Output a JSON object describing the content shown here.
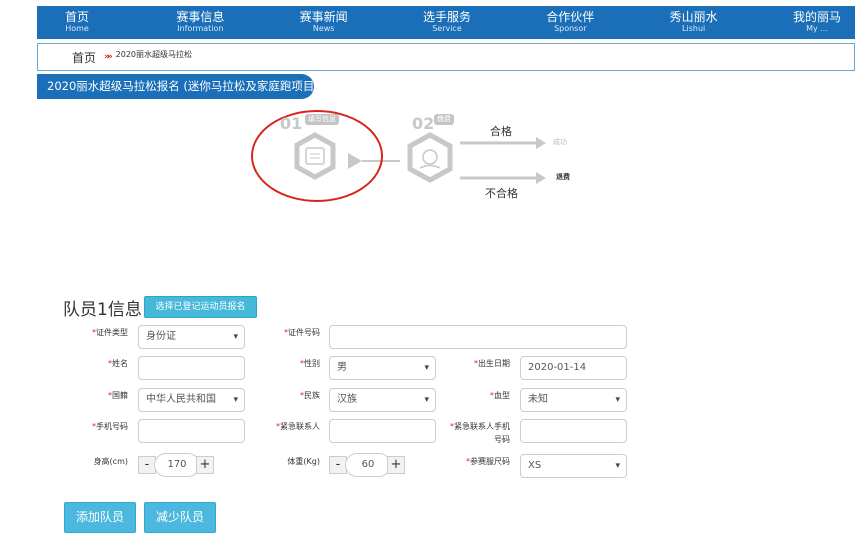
{
  "nav": [
    {
      "zh": "首页",
      "en": "Home"
    },
    {
      "zh": "赛事信息",
      "en": "Information"
    },
    {
      "zh": "赛事新闻",
      "en": "News"
    },
    {
      "zh": "选手服务",
      "en": "Service"
    },
    {
      "zh": "合作伙伴",
      "en": "Sponsor"
    },
    {
      "zh": "秀山丽水",
      "en": "Lishui"
    },
    {
      "zh": "我的丽马",
      "en": "My ..."
    }
  ],
  "breadcrumb": {
    "home": "首页",
    "sep": "»»",
    "current": "2020丽水超级马拉松"
  },
  "banner": "2020丽水超级马拉松报名 (迷你马拉松及家庭跑项目)",
  "flow": {
    "step1_no": "01",
    "step1_tag": "填写信息",
    "step2_no": "02",
    "step2_tag": "缴费",
    "pass": "合格",
    "fail": "不合格",
    "success": "成功",
    "refund": "退费"
  },
  "form": {
    "title": "队员1信息",
    "pick_button": "选择已登记运动员报名",
    "id_type_label": "证件类型",
    "id_type_value": "身份证",
    "id_no_label": "证件号码",
    "id_no_value": "",
    "name_label": "姓名",
    "name_value": "",
    "gender_label": "性别",
    "gender_value": "男",
    "birth_label": "出生日期",
    "birth_value": "2020-01-14",
    "country_label": "国籍",
    "country_value": "中华人民共和国",
    "ethnic_label": "民族",
    "ethnic_value": "汉族",
    "blood_label": "血型",
    "blood_value": "未知",
    "phone_label": "手机号码",
    "phone_value": "",
    "emergency_label": "紧急联系人",
    "emergency_value": "",
    "emergency_phone_label": "紧急联系人手机号码",
    "emergency_phone_value": "",
    "height_label": "身高(cm)",
    "height_value": "170",
    "weight_label": "体重(Kg)",
    "weight_value": "60",
    "size_label": "参赛服尺码",
    "size_value": "XS",
    "minus": "-",
    "plus": "+"
  },
  "actions": {
    "add": "添加队员",
    "remove": "减少队员"
  },
  "colors": {
    "primary": "#1a6fb8",
    "button": "#4cb8e0",
    "required": "#d9261c",
    "highlight_circle": "#d9261c"
  }
}
